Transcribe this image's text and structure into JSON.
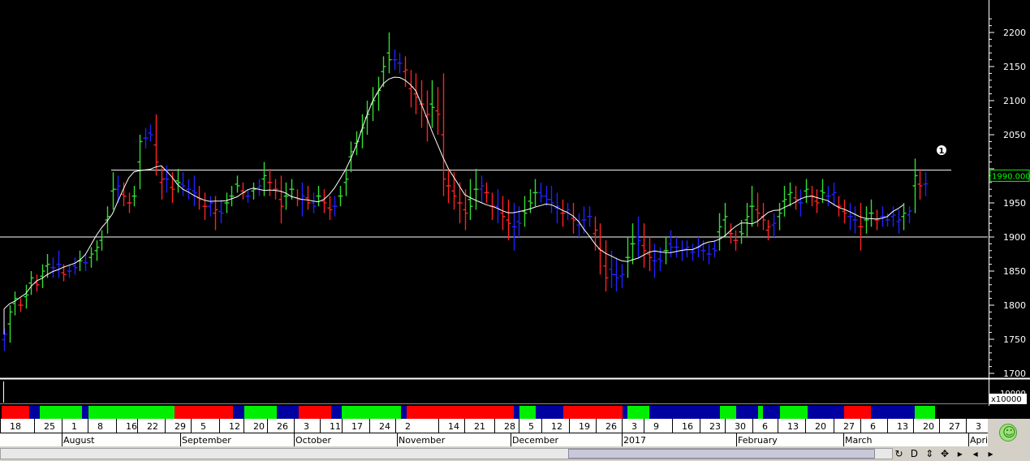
{
  "chart_data": {
    "type": "ohlc",
    "y_axis": {
      "ticks": [
        "2200",
        "2150",
        "2100",
        "2050",
        "1950",
        "1900",
        "1850",
        "1800",
        "1750",
        "1700"
      ],
      "ylim": [
        1695,
        2225
      ]
    },
    "current_price_label": "1990.000",
    "horizontal_lines": [
      1998,
      1900
    ],
    "marker_label": "1",
    "volume_axis_label": "x10000",
    "volume_axis_tick": "10000",
    "series": [
      {
        "name": "bars",
        "values": [
          [
            1766,
            1733,
            1757
          ],
          [
            1800,
            1745,
            1790
          ],
          [
            1820,
            1785,
            1810
          ],
          [
            1810,
            1790,
            1800
          ],
          [
            1830,
            1795,
            1815
          ],
          [
            1850,
            1815,
            1840
          ],
          [
            1845,
            1820,
            1830
          ],
          [
            1860,
            1825,
            1850
          ],
          [
            1875,
            1840,
            1860
          ],
          [
            1870,
            1840,
            1855
          ],
          [
            1880,
            1840,
            1860
          ],
          [
            1860,
            1835,
            1845
          ],
          [
            1860,
            1840,
            1850
          ],
          [
            1870,
            1845,
            1855
          ],
          [
            1880,
            1850,
            1865
          ],
          [
            1875,
            1850,
            1862
          ],
          [
            1885,
            1855,
            1875
          ],
          [
            1895,
            1865,
            1885
          ],
          [
            1910,
            1880,
            1900
          ],
          [
            1945,
            1905,
            1930
          ],
          [
            1995,
            1940,
            1970
          ],
          [
            1990,
            1950,
            1975
          ],
          [
            1980,
            1945,
            1960
          ],
          [
            1965,
            1935,
            1950
          ],
          [
            1975,
            1945,
            1960
          ],
          [
            2050,
            1970,
            2040
          ],
          [
            2060,
            2030,
            2045
          ],
          [
            2065,
            2040,
            2050
          ],
          [
            2080,
            1990,
            2010
          ],
          [
            2005,
            1955,
            1985
          ],
          [
            2005,
            1965,
            1985
          ],
          [
            1995,
            1950,
            1970
          ],
          [
            2000,
            1965,
            1980
          ],
          [
            1995,
            1960,
            1975
          ],
          [
            1985,
            1955,
            1970
          ],
          [
            1990,
            1945,
            1965
          ],
          [
            1975,
            1940,
            1955
          ],
          [
            1965,
            1925,
            1945
          ],
          [
            1960,
            1930,
            1950
          ],
          [
            1960,
            1910,
            1940
          ],
          [
            1955,
            1920,
            1935
          ],
          [
            1965,
            1935,
            1950
          ],
          [
            1975,
            1945,
            1960
          ],
          [
            1990,
            1965,
            1975
          ],
          [
            1980,
            1955,
            1965
          ],
          [
            1970,
            1950,
            1960
          ],
          [
            1980,
            1955,
            1970
          ],
          [
            1985,
            1960,
            1975
          ],
          [
            2010,
            1960,
            1990
          ],
          [
            2000,
            1960,
            1980
          ],
          [
            1985,
            1955,
            1970
          ],
          [
            1990,
            1920,
            1945
          ],
          [
            1980,
            1940,
            1960
          ],
          [
            1985,
            1955,
            1970
          ],
          [
            1970,
            1945,
            1955
          ],
          [
            1980,
            1930,
            1960
          ],
          [
            1975,
            1940,
            1950
          ],
          [
            1965,
            1935,
            1945
          ],
          [
            1975,
            1945,
            1960
          ],
          [
            1970,
            1935,
            1950
          ],
          [
            1960,
            1925,
            1940
          ],
          [
            1960,
            1930,
            1945
          ],
          [
            1975,
            1945,
            1960
          ],
          [
            2000,
            1960,
            1985
          ],
          [
            2040,
            1995,
            2025
          ],
          [
            2055,
            2020,
            2040
          ],
          [
            2080,
            2030,
            2060
          ],
          [
            2100,
            2050,
            2080
          ],
          [
            2120,
            2070,
            2100
          ],
          [
            2135,
            2085,
            2115
          ],
          [
            2165,
            2120,
            2150
          ],
          [
            2200,
            2140,
            2160
          ],
          [
            2175,
            2145,
            2160
          ],
          [
            2170,
            2140,
            2155
          ],
          [
            2165,
            2120,
            2145
          ],
          [
            2145,
            2090,
            2120
          ],
          [
            2140,
            2080,
            2105
          ],
          [
            2130,
            2060,
            2095
          ],
          [
            2115,
            2040,
            2080
          ],
          [
            2130,
            2060,
            2090
          ],
          [
            2120,
            2050,
            2080
          ],
          [
            2140,
            1960,
            1985
          ],
          [
            2000,
            1950,
            1975
          ],
          [
            1995,
            1940,
            1960
          ],
          [
            1980,
            1920,
            1950
          ],
          [
            1970,
            1910,
            1935
          ],
          [
            1985,
            1925,
            1945
          ],
          [
            2000,
            1940,
            1970
          ],
          [
            1990,
            1950,
            1975
          ],
          [
            1980,
            1950,
            1965
          ],
          [
            1965,
            1925,
            1945
          ],
          [
            1970,
            1920,
            1940
          ],
          [
            1960,
            1910,
            1930
          ],
          [
            1955,
            1895,
            1920
          ],
          [
            1950,
            1880,
            1915
          ],
          [
            1945,
            1900,
            1920
          ],
          [
            1960,
            1915,
            1935
          ],
          [
            1970,
            1935,
            1950
          ],
          [
            1985,
            1945,
            1965
          ],
          [
            1980,
            1950,
            1960
          ],
          [
            1975,
            1945,
            1955
          ],
          [
            1975,
            1935,
            1950
          ],
          [
            1965,
            1920,
            1945
          ],
          [
            1955,
            1915,
            1935
          ],
          [
            1950,
            1925,
            1940
          ],
          [
            1950,
            1905,
            1925
          ],
          [
            1935,
            1900,
            1918
          ],
          [
            1945,
            1905,
            1925
          ],
          [
            1945,
            1915,
            1930
          ],
          [
            1930,
            1880,
            1910
          ],
          [
            1920,
            1845,
            1880
          ],
          [
            1895,
            1820,
            1840
          ],
          [
            1880,
            1825,
            1845
          ],
          [
            1870,
            1820,
            1840
          ],
          [
            1860,
            1825,
            1845
          ],
          [
            1900,
            1840,
            1870
          ],
          [
            1920,
            1860,
            1890
          ],
          [
            1930,
            1870,
            1895
          ],
          [
            1920,
            1855,
            1880
          ],
          [
            1900,
            1850,
            1870
          ],
          [
            1890,
            1840,
            1865
          ],
          [
            1885,
            1850,
            1865
          ],
          [
            1900,
            1860,
            1880
          ],
          [
            1910,
            1870,
            1885
          ],
          [
            1900,
            1870,
            1885
          ],
          [
            1895,
            1865,
            1880
          ],
          [
            1895,
            1870,
            1885
          ],
          [
            1890,
            1865,
            1878
          ],
          [
            1900,
            1870,
            1885
          ],
          [
            1895,
            1865,
            1880
          ],
          [
            1890,
            1860,
            1875
          ],
          [
            1895,
            1870,
            1880
          ],
          [
            1935,
            1880,
            1915
          ],
          [
            1950,
            1900,
            1930
          ],
          [
            1920,
            1890,
            1905
          ],
          [
            1910,
            1880,
            1895
          ],
          [
            1925,
            1890,
            1905
          ],
          [
            1950,
            1900,
            1930
          ],
          [
            1975,
            1915,
            1945
          ],
          [
            1965,
            1915,
            1935
          ],
          [
            1950,
            1910,
            1925
          ],
          [
            1925,
            1895,
            1915
          ],
          [
            1935,
            1900,
            1920
          ],
          [
            1950,
            1910,
            1935
          ],
          [
            1975,
            1930,
            1955
          ],
          [
            1980,
            1945,
            1965
          ],
          [
            1975,
            1940,
            1955
          ],
          [
            1970,
            1930,
            1950
          ],
          [
            1985,
            1950,
            1970
          ],
          [
            1975,
            1945,
            1960
          ],
          [
            1970,
            1935,
            1950
          ],
          [
            1985,
            1950,
            1965
          ],
          [
            1975,
            1945,
            1960
          ],
          [
            1980,
            1945,
            1965
          ],
          [
            1960,
            1930,
            1945
          ],
          [
            1955,
            1920,
            1935
          ],
          [
            1950,
            1910,
            1930
          ],
          [
            1945,
            1905,
            1925
          ],
          [
            1950,
            1880,
            1915
          ],
          [
            1945,
            1905,
            1925
          ],
          [
            1955,
            1915,
            1935
          ],
          [
            1940,
            1910,
            1925
          ],
          [
            1945,
            1915,
            1930
          ],
          [
            1935,
            1915,
            1925
          ],
          [
            1945,
            1915,
            1932
          ],
          [
            1940,
            1905,
            1925
          ],
          [
            1950,
            1910,
            1935
          ],
          [
            1945,
            1920,
            1938
          ],
          [
            2015,
            1935,
            1990
          ],
          [
            2000,
            1955,
            1975
          ],
          [
            1995,
            1960,
            1978
          ]
        ]
      },
      {
        "name": "moving-average",
        "values": []
      }
    ],
    "color_strip": [
      [
        "#ff0000",
        34
      ],
      [
        "#0000a0",
        13
      ],
      [
        "#00ee00",
        52
      ],
      [
        "#0000a0",
        8
      ],
      [
        "#00ee00",
        106
      ],
      [
        "#ff0000",
        72
      ],
      [
        "#0000a0",
        14
      ],
      [
        "#00ee00",
        40
      ],
      [
        "#0000a0",
        27
      ],
      [
        "#ff0000",
        40
      ],
      [
        "#0000a0",
        13
      ],
      [
        "#00ee00",
        73
      ],
      [
        "#0000a0",
        7
      ],
      [
        "#ff0000",
        132
      ],
      [
        "#0000a0",
        7
      ],
      [
        "#00ee00",
        20
      ],
      [
        "#0000a0",
        34
      ],
      [
        "#ff0000",
        73
      ],
      [
        "#0000a0",
        6
      ],
      [
        "#00ee00",
        27
      ],
      [
        "#0000a0",
        87
      ],
      [
        "#00ee00",
        20
      ],
      [
        "#0000a0",
        27
      ],
      [
        "#00ee00",
        6
      ],
      [
        "#0000a0",
        21
      ],
      [
        "#00ee00",
        34
      ],
      [
        "#0000a0",
        45
      ],
      [
        "#ff0000",
        33
      ],
      [
        "#0000a0",
        54
      ],
      [
        "#00ee00",
        25
      ]
    ],
    "day_labels": [
      "18",
      "25",
      "1",
      "8",
      "16",
      "22",
      "29",
      "5",
      "12",
      "20",
      "26",
      "3",
      "11",
      "17",
      "24",
      "2",
      "14",
      "21",
      "28",
      "5",
      "12",
      "19",
      "26",
      "3",
      "9",
      "16",
      "23",
      "30",
      "6",
      "13",
      "20",
      "27",
      "6",
      "13",
      "20",
      "27",
      "3"
    ],
    "month_labels": [
      "August",
      "September",
      "October",
      "November",
      "December",
      "2017",
      "February",
      "March",
      "Apri"
    ]
  },
  "ui": {
    "scroll_buttons": [
      "↻",
      "D",
      "⇕",
      "✥",
      "▸",
      "◂",
      "▸"
    ]
  },
  "colors": {
    "up": "#33dd33",
    "down": "#ff2222",
    "neutral": "#2222ff",
    "ma": "#ffffff",
    "axis": "#ffffff",
    "current": "#00ff00"
  }
}
